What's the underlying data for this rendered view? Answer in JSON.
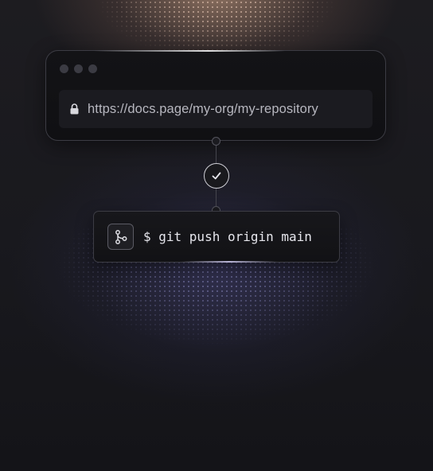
{
  "browser": {
    "url": "https://docs.page/my-org/my-repository",
    "traffic_light_color": "#3b3b43"
  },
  "status": {
    "icon": "checkmark-icon"
  },
  "terminal": {
    "command": "$ git push origin main",
    "icon": "git-branch-icon"
  },
  "colors": {
    "background": "#17171c",
    "top_glow": "#ecba98",
    "bottom_glow": "#464478",
    "text": "#e6e6ec"
  }
}
